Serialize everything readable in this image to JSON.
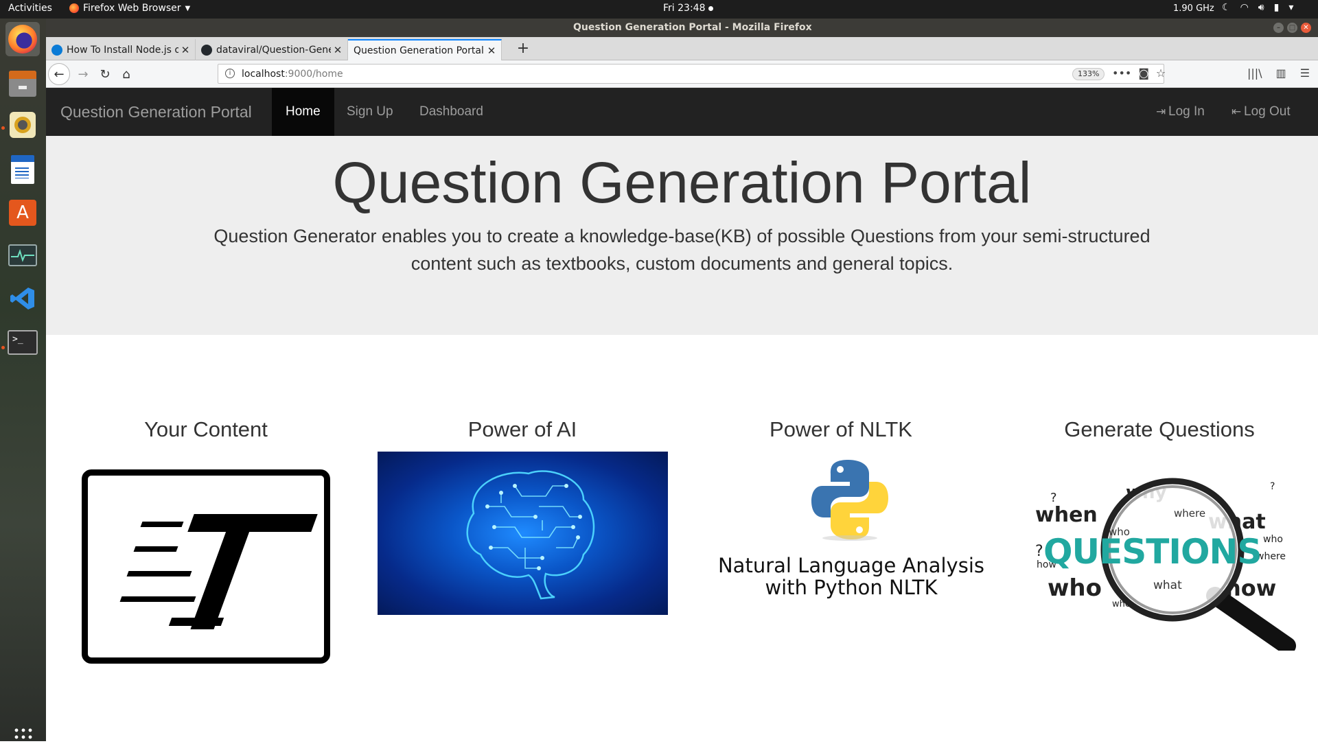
{
  "system_bar": {
    "activities": "Activities",
    "app_name": "Firefox Web Browser",
    "clock": "Fri 23:48",
    "cpu": "1.90 GHz"
  },
  "window": {
    "title": "Question Generation Portal - Mozilla Firefox"
  },
  "tabs": [
    {
      "label": "How To Install Node.js o",
      "active": false
    },
    {
      "label": "dataviral/Question-Gene",
      "active": false
    },
    {
      "label": "Question Generation Portal",
      "active": true
    }
  ],
  "address_bar": {
    "host": "localhost",
    "path": ":9000/home",
    "zoom": "133%"
  },
  "site": {
    "brand": "Question Generation Portal",
    "nav": {
      "home": "Home",
      "signup": "Sign Up",
      "dashboard": "Dashboard",
      "login": "Log In",
      "logout": "Log Out"
    },
    "hero": {
      "title": "Question Generation Portal",
      "description": "Question Generator enables you to create a knowledge-base(KB) of possible Questions from your semi-structured content such as textbooks, custom documents and general topics."
    },
    "features": [
      {
        "title": "Your Content"
      },
      {
        "title": "Power of AI"
      },
      {
        "title": "Power of NLTK",
        "image_text_line1": "Natural Language Analysis",
        "image_text_line2": "with Python NLTK"
      },
      {
        "title": "Generate Questions",
        "image_word": "QUESTIONS"
      }
    ]
  },
  "colors": {
    "navbar_bg": "#222222",
    "navbar_active": "#080808",
    "jumbotron_bg": "#eeeeee",
    "tab_accent": "#0a84ff"
  }
}
